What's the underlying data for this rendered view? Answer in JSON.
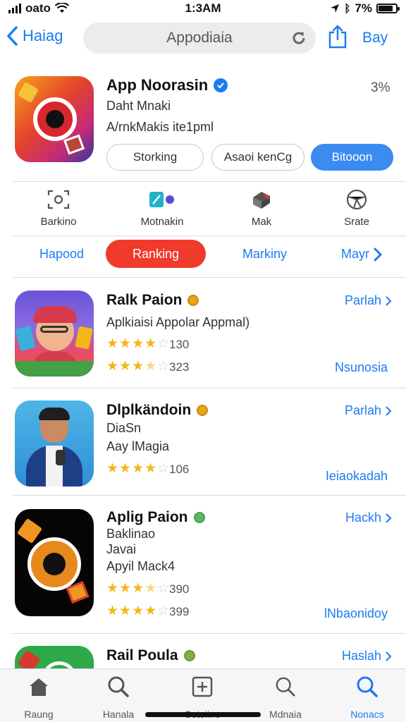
{
  "status_bar": {
    "carrier": "oato",
    "time": "1:3AM",
    "battery_text": "7%",
    "battery_level": 0.85
  },
  "nav": {
    "back_label": "Haiag",
    "search_text": "Appodiaia",
    "buy_label": "Bay"
  },
  "featured": {
    "title": "App Noorasin",
    "subtitle": "Daht Mnaki",
    "meta": "A/rnkMakis ite1pml",
    "percent": "3%",
    "buttons": [
      "Storking",
      "Asaoi kenCg",
      "Bitooon"
    ],
    "accent_color": "#3b8bf0"
  },
  "categories": [
    {
      "label": "Barkino",
      "icon": "scan-icon"
    },
    {
      "label": "Motnakin",
      "icon": "chart-icon"
    },
    {
      "label": "Mak",
      "icon": "box-icon"
    },
    {
      "label": "Srate",
      "icon": "globe-icon"
    }
  ],
  "segment": {
    "left": "Hapood",
    "active": "Ranking",
    "right": "Markiny",
    "more": "Mayr",
    "active_color": "#ef3a2c"
  },
  "list": [
    {
      "title": "Ralk Paion",
      "line1": "Aplkiaisi Appolar Appmal)",
      "line2": "",
      "rating1": 4,
      "count1": "130",
      "rating2": 3.5,
      "count2": "323",
      "link": "Parlah",
      "tag": "Nsunosia",
      "dot_color": "#e9a514"
    },
    {
      "title": "Dlplkändoin",
      "line1": "DiaSn",
      "line2": "Aay lMagia",
      "rating1": 4,
      "count1": "106",
      "rating2": null,
      "count2": "",
      "link": "Parlah",
      "tag": "Ieiaokadah",
      "dot_color": "#e9a514"
    },
    {
      "title": "Aplig Paion",
      "line1": "Baklinao",
      "line2": "Javai",
      "line3": "Apyil Mack4",
      "rating1": 3.5,
      "count1": "390",
      "rating2": 4,
      "count2": "399",
      "link": "Hackh",
      "tag": "lNbaonidoy",
      "dot_color": "#5cb85c"
    },
    {
      "title": "Rail Poula",
      "link": "Haslah",
      "dot_color": "#7cb342"
    }
  ],
  "tabs": [
    {
      "label": "Raung",
      "icon": "home-icon"
    },
    {
      "label": "Hanala",
      "icon": "search-icon"
    },
    {
      "label": "Cotoiine",
      "icon": "plus-square-icon"
    },
    {
      "label": "Mdnaia",
      "icon": "search-icon"
    },
    {
      "label": "Nonacs",
      "icon": "search-icon"
    }
  ]
}
